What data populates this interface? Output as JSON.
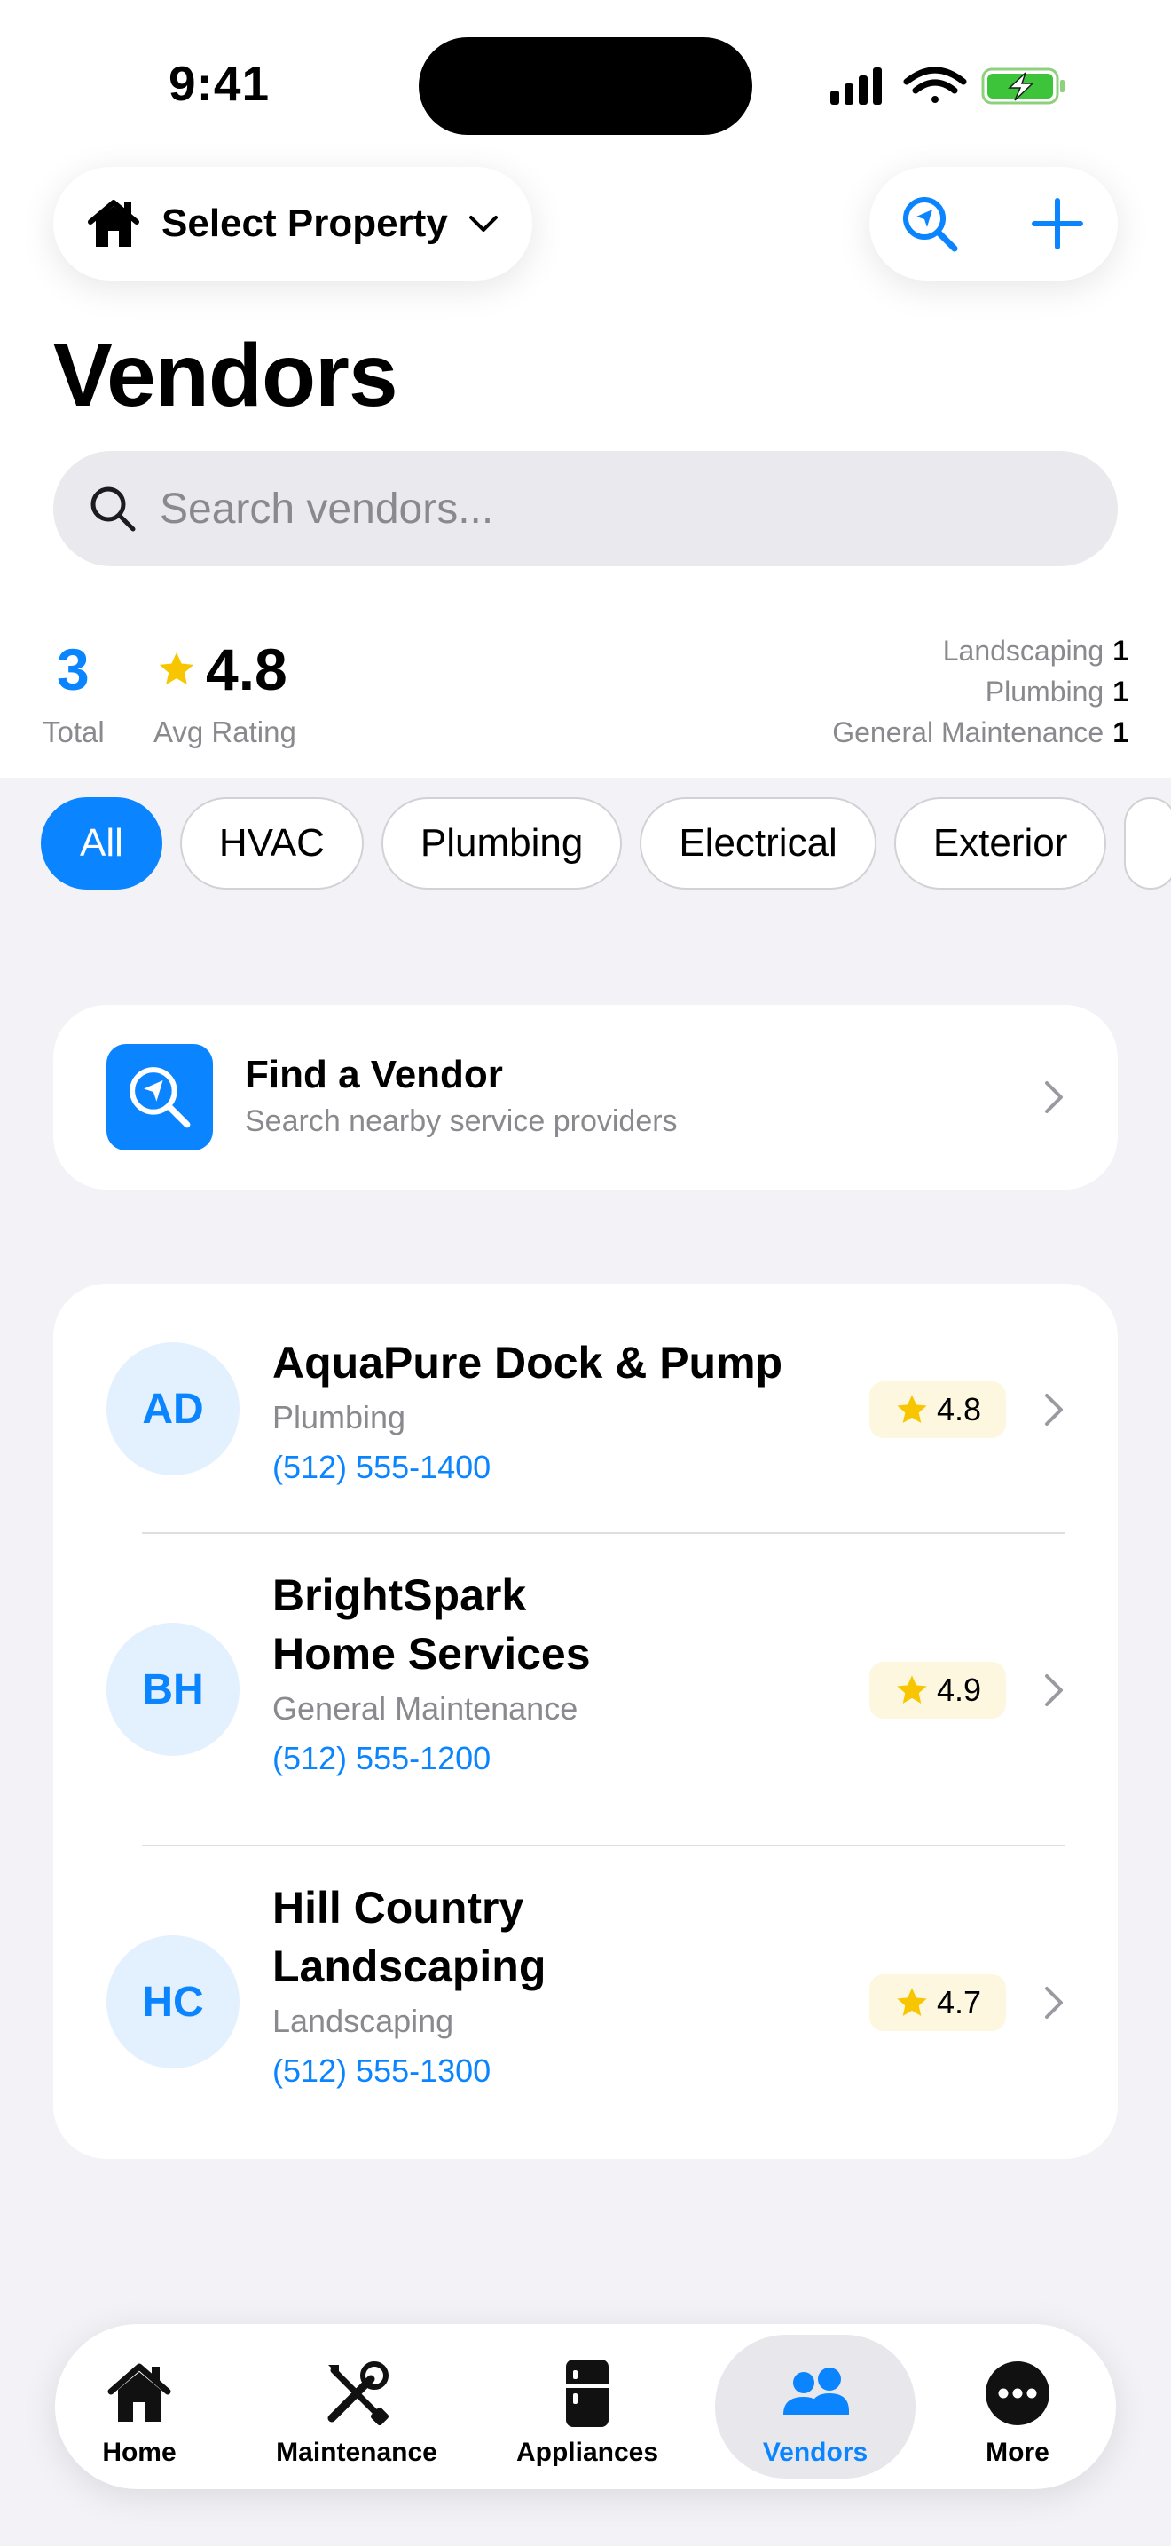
{
  "status_bar": {
    "time": "9:41"
  },
  "header": {
    "property_label": "Select Property",
    "title": "Vendors"
  },
  "search": {
    "placeholder": "Search vendors..."
  },
  "stats": {
    "total": "3",
    "total_label": "Total",
    "avg_rating": "4.8",
    "avg_rating_label": "Avg Rating",
    "breakdown": [
      {
        "label": "Landscaping",
        "count": "1"
      },
      {
        "label": "Plumbing",
        "count": "1"
      },
      {
        "label": "General Maintenance",
        "count": "1"
      }
    ]
  },
  "filters": [
    {
      "label": "All",
      "active": true
    },
    {
      "label": "HVAC"
    },
    {
      "label": "Plumbing"
    },
    {
      "label": "Electrical"
    },
    {
      "label": "Exterior"
    }
  ],
  "find_vendor": {
    "title": "Find a Vendor",
    "subtitle": "Search nearby service providers"
  },
  "vendors": [
    {
      "initials": "AD",
      "name_lines": [
        "AquaPure Dock & Pump"
      ],
      "category": "Plumbing",
      "phone": "(512) 555-1400",
      "rating": "4.8"
    },
    {
      "initials": "BH",
      "name_lines": [
        "BrightSpark",
        "Home Services"
      ],
      "category": "General Maintenance",
      "phone": "(512) 555-1200",
      "rating": "4.9"
    },
    {
      "initials": "HC",
      "name_lines": [
        "Hill Country",
        "Landscaping"
      ],
      "category": "Landscaping",
      "phone": "(512) 555-1300",
      "rating": "4.7"
    }
  ],
  "tabs": [
    {
      "label": "Home",
      "icon": "house-icon"
    },
    {
      "label": "Maintenance",
      "icon": "tools-icon"
    },
    {
      "label": "Appliances",
      "icon": "fridge-icon"
    },
    {
      "label": "Vendors",
      "icon": "people-icon",
      "active": true
    },
    {
      "label": "More",
      "icon": "more-icon"
    }
  ],
  "colors": {
    "accent": "#0a84ff",
    "star": "#f7c600",
    "background": "#f2f2f7"
  }
}
